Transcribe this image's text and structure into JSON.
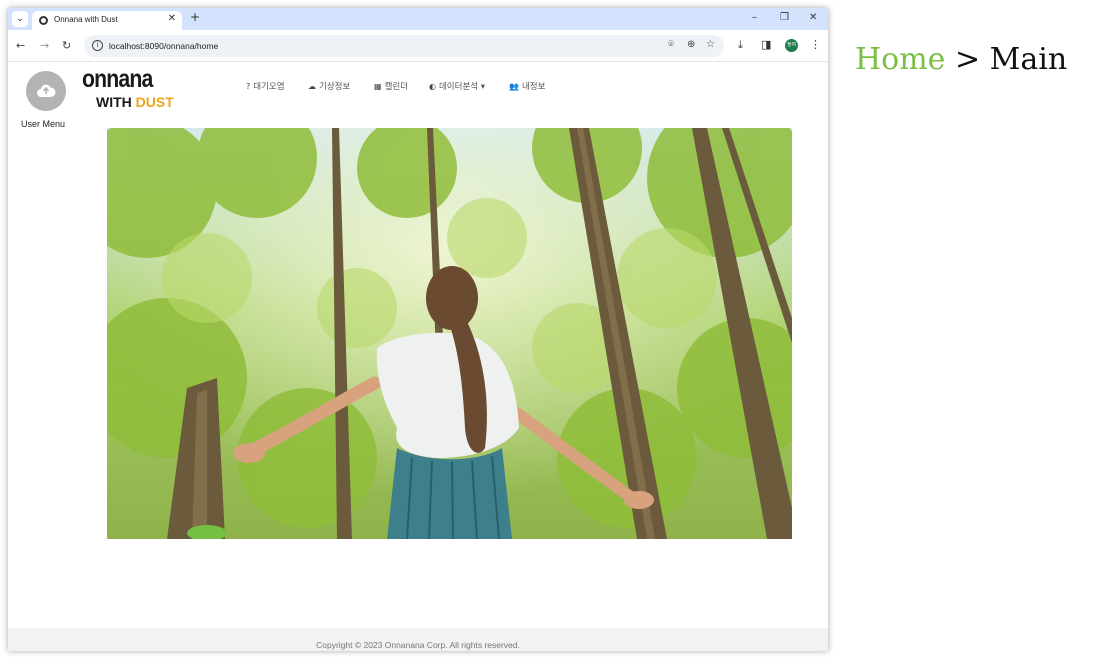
{
  "browser": {
    "tab_title": "Onnana with Dust",
    "url": "localhost:8090/onnana/home",
    "profile_initials": "정여"
  },
  "header": {
    "user_menu_label": "User Menu",
    "logo_top": "onnana",
    "logo_with": "WITH",
    "logo_dust": "DUST",
    "nav": [
      {
        "icon": "question-icon",
        "label": "대기오염"
      },
      {
        "icon": "weather-icon",
        "label": "기상정보"
      },
      {
        "icon": "calendar-icon",
        "label": "캘린더"
      },
      {
        "icon": "brain-icon",
        "label": "데이터분석"
      },
      {
        "icon": "users-icon",
        "label": "내정보"
      }
    ],
    "nav_dropdown_caret": "▾"
  },
  "footer": {
    "copyright": "Copyright © 2023 Onnanana Corp. All rights reserved."
  },
  "breadcrumb": {
    "home": "Home",
    "separator": ">",
    "current": "Main"
  },
  "colors": {
    "breadcrumb_home": "#7cc043",
    "logo_dust": "#f0a418",
    "tabbar": "#d3e3fd"
  }
}
